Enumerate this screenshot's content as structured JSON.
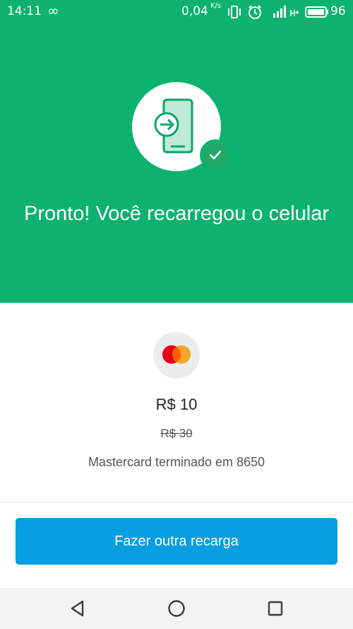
{
  "status_bar": {
    "time": "14:11",
    "infinity_glyph": "∞",
    "network_speed": "0,04",
    "network_speed_unit": "K/s",
    "battery_level": "96",
    "icons": [
      "infinity-icon",
      "vibrate-icon",
      "alarm-icon",
      "signal-icon",
      "hplus-icon",
      "battery-icon"
    ]
  },
  "success": {
    "icon": "phone-recharge-icon",
    "badge_icon": "check-icon",
    "title": "Pronto! Você recarregou o celular"
  },
  "payment": {
    "card_icon": "mastercard-icon",
    "amount": "R$ 10",
    "original_amount": "R$ 30",
    "card_description": "Mastercard terminado em 8650"
  },
  "actions": {
    "primary_label": "Fazer outra recarga"
  },
  "nav_bar": {
    "buttons": [
      "back-icon",
      "home-icon",
      "recents-icon"
    ]
  },
  "colors": {
    "brand_green": "#0db26f",
    "check_green": "#22a96a",
    "button_blue": "#069ee1",
    "mastercard_red": "#eb001b",
    "mastercard_orange": "#f79e1b"
  }
}
